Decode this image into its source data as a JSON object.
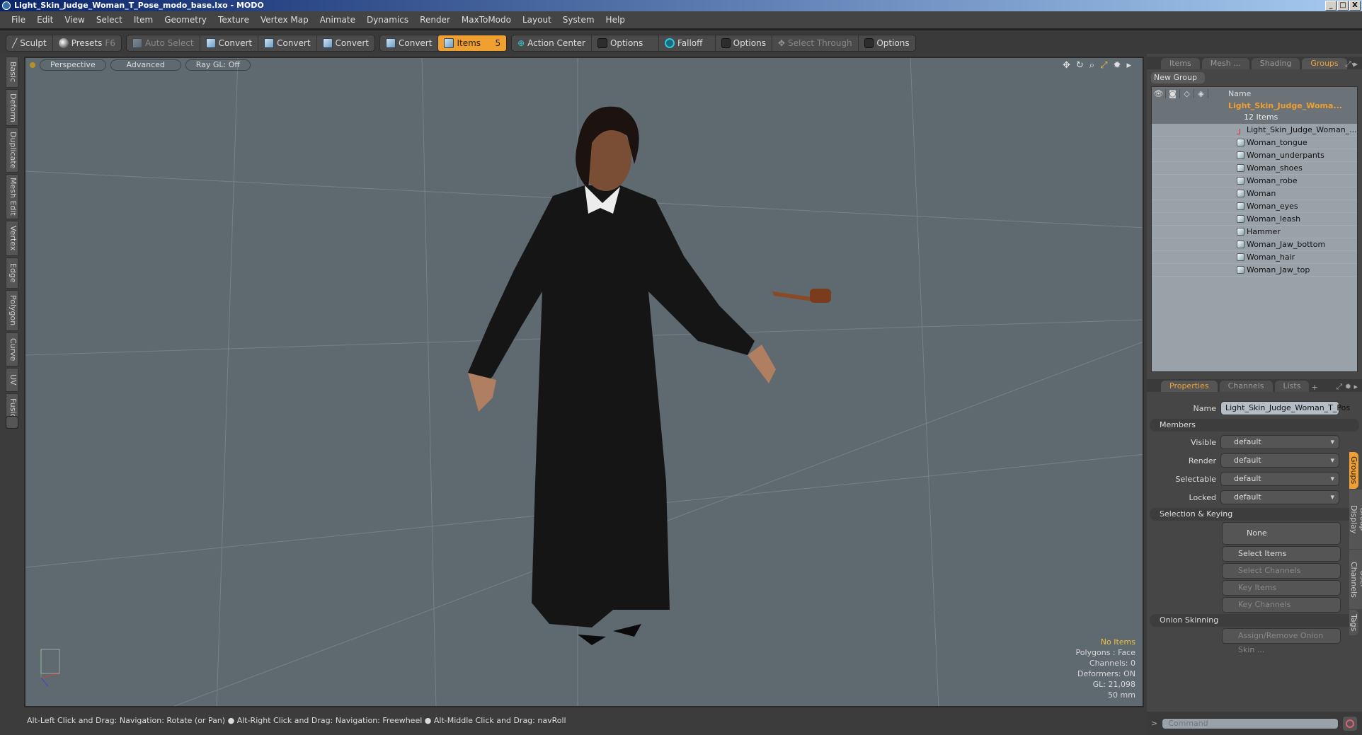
{
  "window": {
    "title": "Light_Skin_Judge_Woman_T_Pose_modo_base.lxo - MODO",
    "controls": [
      "_",
      "□",
      "X"
    ]
  },
  "menu": [
    "File",
    "Edit",
    "View",
    "Select",
    "Item",
    "Geometry",
    "Texture",
    "Vertex Map",
    "Animate",
    "Dynamics",
    "Render",
    "MaxToModo",
    "Layout",
    "System",
    "Help"
  ],
  "toolbar": {
    "sculpt": "Sculpt",
    "presets": "Presets",
    "presets_key": "F6",
    "auto_select": "Auto Select",
    "convert": "Convert",
    "items": "Items",
    "items_key": "5",
    "action_center": "Action Center",
    "options": "Options",
    "falloff": "Falloff",
    "select_through": "Select Through"
  },
  "left_tabs": [
    "Basic",
    "Deform",
    "Duplicate",
    "Mesh Edit",
    "Vertex",
    "Edge",
    "Polygon",
    "Curve",
    "UV",
    "Fusion"
  ],
  "viewport": {
    "view": "Perspective",
    "shading": "Advanced",
    "raygl": "Ray GL: Off",
    "info": {
      "items": "No Items",
      "polygons": "Polygons : Face",
      "channels": "Channels: 0",
      "deformers": "Deformers: ON",
      "gl": "GL: 21,098",
      "lens": "50 mm"
    }
  },
  "status": "Alt-Left Click and Drag: Navigation: Rotate (or Pan) ● Alt-Right Click and Drag: Navigation: Freewheel ● Alt-Middle Click and Drag: navRoll",
  "right_panel": {
    "tabs": [
      "Items",
      "Mesh ...",
      "Shading",
      "Groups"
    ],
    "new_group": "New Group",
    "name_col": "Name",
    "group": {
      "name": "Light_Skin_Judge_Woma...",
      "count": "12 Items"
    },
    "items": [
      "Light_Skin_Judge_Woman_...",
      "Woman_tongue",
      "Woman_underpants",
      "Woman_shoes",
      "Woman_robe",
      "Woman",
      "Woman_eyes",
      "Woman_leash",
      "Hammer",
      "Woman_Jaw_bottom",
      "Woman_hair",
      "Woman_Jaw_top"
    ],
    "prop_tabs": [
      "Properties",
      "Channels",
      "Lists",
      "+"
    ],
    "name_label": "Name",
    "name_value": "Light_Skin_Judge_Woman_T_Pos",
    "members": "Members",
    "fields": [
      {
        "label": "Visible",
        "value": "default"
      },
      {
        "label": "Render",
        "value": "default"
      },
      {
        "label": "Selectable",
        "value": "default"
      },
      {
        "label": "Locked",
        "value": "default"
      }
    ],
    "sel_keying": "Selection & Keying",
    "none": "None",
    "select_items": "Select Items",
    "select_channels": "Select Channels",
    "key_items": "Key Items",
    "key_channels": "Key Channels",
    "onion": "Onion Skinning",
    "assign_onion": "Assign/Remove Onion Skin ...",
    "side_tabs": [
      "Groups",
      "Group Display",
      "User Channels",
      "Tags"
    ]
  },
  "command": {
    "placeholder": "Command",
    "prompt": ">"
  }
}
